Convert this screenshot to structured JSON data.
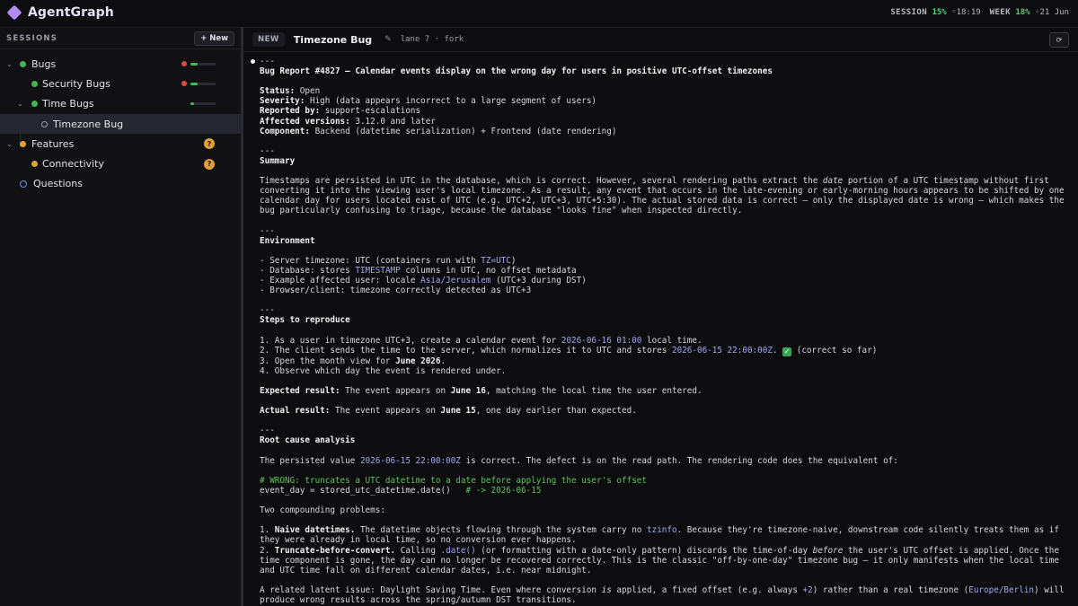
{
  "app": {
    "name": "AgentGraph",
    "usage": {
      "session_label": "SESSION",
      "session_pct": "15%",
      "session_time": "◦18:19",
      "week_label": "WEEK",
      "week_pct": "18%",
      "week_date": "◦21 Jun"
    }
  },
  "sidebar": {
    "title": "SESSIONS",
    "new_label": "+ New",
    "items": [
      {
        "label": "Bugs",
        "progress": 0.3
      },
      {
        "label": "Security Bugs",
        "progress": 0.3
      },
      {
        "label": "Time Bugs",
        "progress": 0.15
      },
      {
        "label": "Timezone Bug"
      },
      {
        "label": "Features",
        "badge": "?"
      },
      {
        "label": "Connectivity",
        "badge": "?"
      },
      {
        "label": "Questions"
      }
    ],
    "colors": {
      "done": "#3fb757",
      "pending": "#e0a032",
      "error": "#e5483f",
      "active": "#6c8fe6"
    }
  },
  "header": {
    "tag": "NEW",
    "title": "Timezone Bug",
    "edit_icon": "pencil-icon",
    "lane": "lane 7 · fork",
    "action_icon": "refresh-icon"
  },
  "doc": {
    "l1": "---",
    "title": "Bug Report #4827 — Calendar events display on the wrong day for users in positive UTC-offset timezones",
    "status_k": "Status:",
    "status_v": " Open",
    "severity_k": "Severity:",
    "severity_v": " High (data appears incorrect to a large segment of users)",
    "reported_k": "Reported by:",
    "reported_v": " support-escalations",
    "versions_k": "Affected versions:",
    "versions_v": " 3.12.0 and later",
    "component_k": "Component:",
    "component_v": " Backend (datetime serialization) + Frontend (date rendering)",
    "sep": "---",
    "summary_h": "Summary",
    "summary_a": "Timestamps are persisted in UTC in the database, which is correct. However, several rendering paths extract the ",
    "summary_i": "date",
    "summary_b": " portion of a UTC timestamp without first converting it into the viewing user's local timezone. As a result, any event that occurs in the late-evening or early-morning hours appears to be shifted by one calendar day for users located east of UTC (e.g. UTC+2, UTC+3, UTC+5:30). The actual stored data is correct — only the displayed date is wrong — which makes the bug particularly confusing to triage, because the database \"looks fine\" when inspected directly.",
    "env_h": "Environment",
    "env1_a": "- Server timezone: UTC (containers run with ",
    "env1_c": "TZ=UTC",
    "env1_b": ")",
    "env2_a": "- Database: stores ",
    "env2_c": "TIMESTAMP",
    "env2_b": " columns in UTC, no offset metadata",
    "env3_a": "- Example affected user: locale ",
    "env3_c": "Asia/Jerusalem",
    "env3_b": " (UTC+3 during DST)",
    "env4": "- Browser/client: timezone correctly detected as UTC+3",
    "steps_h": "Steps to reproduce",
    "s1_a": "1. As a user in timezone UTC+3, create a calendar event for ",
    "s1_c": "2026-06-16 01:00",
    "s1_b": " local time.",
    "s2_a": "2. The client sends the time to the server, which normalizes it to UTC and stores ",
    "s2_c": "2026-06-15 22:00:00Z",
    "s2_b": ". ",
    "s2_check": "✓",
    "s2_d": " (correct so far)",
    "s3_a": "3. Open the month view for ",
    "s3_bold": "June 2026",
    "s3_b": ".",
    "s4": "4. Observe which day the event is rendered under.",
    "exp_k": "Expected result:",
    "exp_a": " The event appears on ",
    "exp_bold": "June 16",
    "exp_b": ", matching the local time the user entered.",
    "act_k": "Actual result:",
    "act_a": " The event appears on ",
    "act_bold": "June 15",
    "act_b": ", one day earlier than expected.",
    "root_h": "Root cause analysis",
    "root_a": "The persisted value ",
    "root_c": "2026-06-15 22:00:00Z",
    "root_b": " is correct. The defect is on the read path. The rendering code does the equivalent of:",
    "code1": "# WRONG: truncates a UTC datetime to a date before applying the user's offset",
    "code2_a": "event_day = stored_utc_datetime.date()   ",
    "code2_c": "# -> 2026-06-15",
    "two": "Two compounding problems:",
    "p1_a": "1. ",
    "p1_bold": "Naive datetimes.",
    "p1_b": " The datetime objects flowing through the system carry no ",
    "p1_c": "tzinfo",
    "p1_d": ". Because they're timezone-naive, downstream code silently treats them as if they were already in local time, so no conversion ever happens.",
    "p2_a": "2. ",
    "p2_bold": "Truncate-before-convert.",
    "p2_b": " Calling ",
    "p2_c": ".date()",
    "p2_d": " (or formatting with a date-only pattern) discards the time-of-day ",
    "p2_i": "before",
    "p2_e": " the user's UTC offset is applied. Once the time component is gone, the day can no longer be recovered correctly. This is the classic \"off-by-one-day\" timezone bug — it only manifests when the local time and UTC time fall on different calendar dates, i.e. near midnight.",
    "rel_a": "A related latent issue: Daylight Saving Time. Even where conversion ",
    "rel_i": "is",
    "rel_b": " applied, a fixed offset (e.g. always ",
    "rel_c": "+2",
    "rel_d": ") rather than a real timezone (",
    "rel_c2": "Europe/Berlin",
    "rel_e": ") will produce wrong results across the spring/autumn DST transitions."
  }
}
